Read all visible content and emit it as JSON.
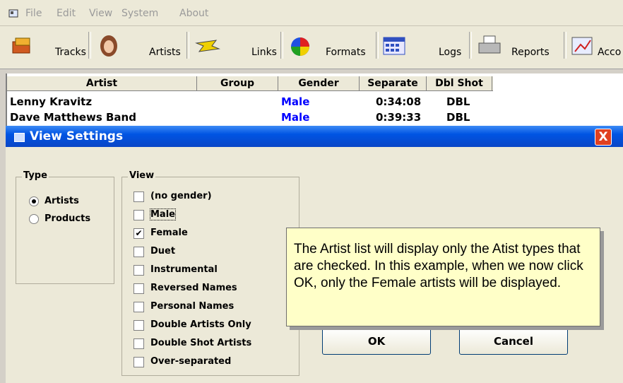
{
  "menu": {
    "file": "File",
    "edit": "Edit",
    "view": "View",
    "system": "System",
    "about": "About"
  },
  "toolbar": {
    "tracks": "Tracks",
    "artists": "Artists",
    "links": "Links",
    "formats": "Formats",
    "logs": "Logs",
    "reports": "Reports",
    "acco": "Acco"
  },
  "grid": {
    "headers": {
      "artist": "Artist",
      "group": "Group",
      "gender": "Gender",
      "separate": "Separate",
      "dblshot": "Dbl Shot"
    },
    "rows": [
      {
        "artist": "Lenny Kravitz",
        "gender": "Male",
        "separate": "0:34:08",
        "dbl": "DBL"
      },
      {
        "artist": "Dave Matthews Band",
        "gender": "Male",
        "separate": "0:39:33",
        "dbl": "DBL"
      }
    ],
    "gender_color": "#0000ff"
  },
  "dialog": {
    "title": "View Settings",
    "close": "X",
    "type_group": "Type",
    "type_options": [
      {
        "label": "Artists",
        "selected": true
      },
      {
        "label": "Products",
        "selected": false
      }
    ],
    "view_group": "View",
    "view_options": [
      {
        "label": "(no gender)",
        "checked": false
      },
      {
        "label": "Male",
        "checked": false
      },
      {
        "label": "Female",
        "checked": true
      },
      {
        "label": "Duet",
        "checked": false
      },
      {
        "label": "Instrumental",
        "checked": false
      },
      {
        "label": "Reversed Names",
        "checked": false
      },
      {
        "label": "Personal Names",
        "checked": false
      },
      {
        "label": "Double Artists Only",
        "checked": false
      },
      {
        "label": "Double Shot Artists",
        "checked": false
      },
      {
        "label": "Over-separated",
        "checked": false
      }
    ],
    "ok": "OK",
    "cancel": "Cancel",
    "check_mark": "✔"
  },
  "tooltip": "The Artist list will display only the Atist types that are checked.  In this example, when we now click OK, only the Female artists will be displayed."
}
